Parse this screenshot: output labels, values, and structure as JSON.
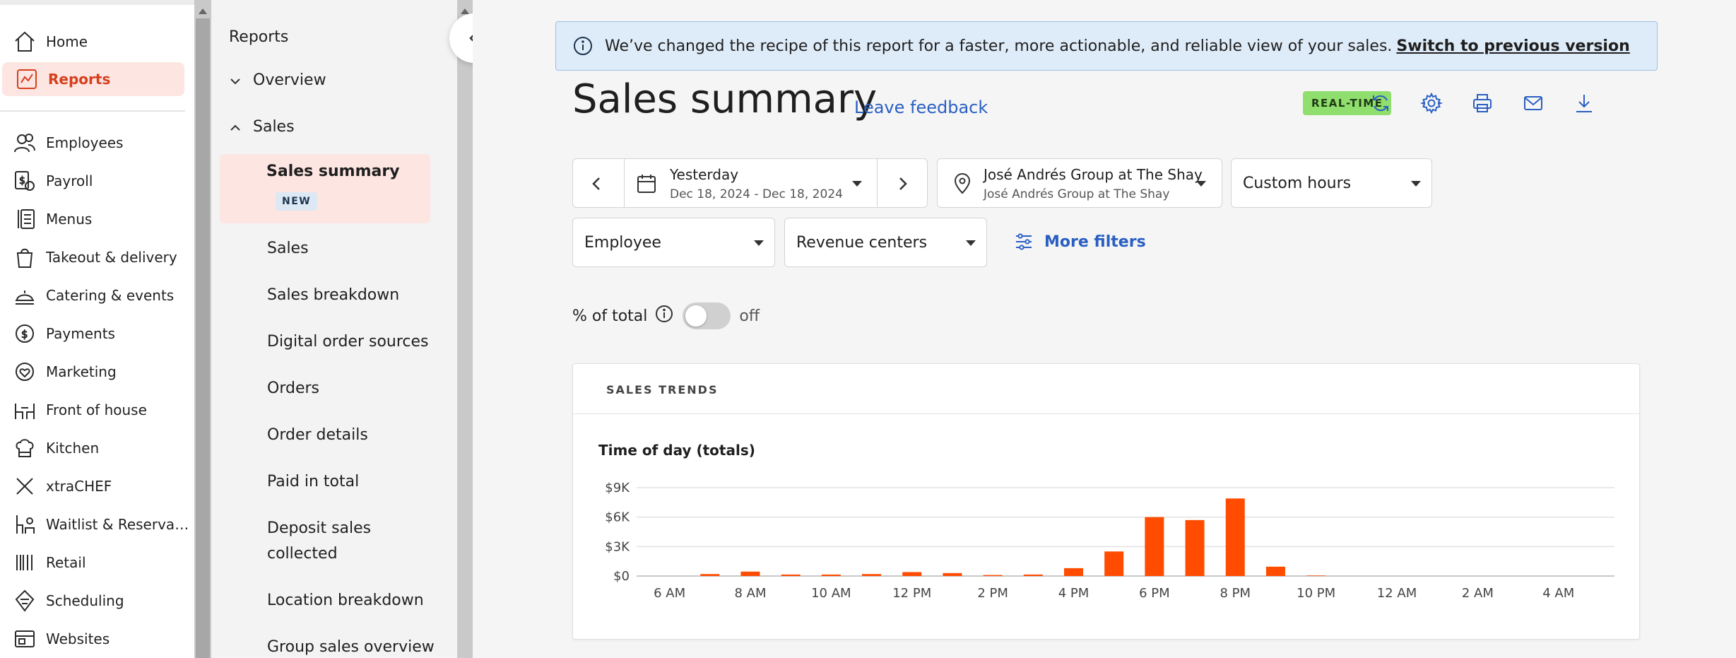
{
  "left_nav": {
    "items": [
      {
        "label": "Home",
        "icon": "home-icon"
      },
      {
        "label": "Reports",
        "icon": "reports-icon",
        "active": true
      },
      {
        "label": "Employees",
        "icon": "employees-icon"
      },
      {
        "label": "Payroll",
        "icon": "payroll-icon"
      },
      {
        "label": "Menus",
        "icon": "menus-icon"
      },
      {
        "label": "Takeout & delivery",
        "icon": "takeout-icon"
      },
      {
        "label": "Catering & events",
        "icon": "catering-icon"
      },
      {
        "label": "Payments",
        "icon": "payments-icon"
      },
      {
        "label": "Marketing",
        "icon": "marketing-icon"
      },
      {
        "label": "Front of house",
        "icon": "front-of-house-icon"
      },
      {
        "label": "Kitchen",
        "icon": "kitchen-icon"
      },
      {
        "label": "xtraCHEF",
        "icon": "xtrachef-icon"
      },
      {
        "label": "Waitlist & Reservati...",
        "icon": "waitlist-icon"
      },
      {
        "label": "Retail",
        "icon": "retail-icon"
      },
      {
        "label": "Scheduling",
        "icon": "scheduling-icon"
      },
      {
        "label": "Websites",
        "icon": "websites-icon"
      }
    ]
  },
  "reports_nav": {
    "title": "Reports",
    "groups": {
      "overview": "Overview",
      "sales": "Sales"
    },
    "active_item": {
      "label": "Sales summary",
      "badge": "NEW"
    },
    "items": [
      "Sales",
      "Sales breakdown",
      "Digital order sources",
      "Orders",
      "Order details",
      "Paid in total",
      "Deposit sales",
      "collected",
      "Location breakdown",
      "Group sales overview"
    ]
  },
  "banner": {
    "text": "We’ve changed the recipe of this report for a faster, more actionable, and reliable view of your sales.",
    "link": "Switch to previous version"
  },
  "header": {
    "title": "Sales summary",
    "feedback_link": "Leave feedback",
    "badge": "REAL-TIME",
    "tools": [
      "refresh-icon",
      "settings-icon",
      "print-icon",
      "email-icon",
      "download-icon"
    ]
  },
  "filters": {
    "date": {
      "label": "Yesterday",
      "range": "Dec 18, 2024 - Dec 18, 2024"
    },
    "location": {
      "label": "José Andrés Group at The Shay",
      "sub": "José Andrés Group at The Shay"
    },
    "hours": "Custom hours",
    "employee": "Employee",
    "revenue_centers": "Revenue centers",
    "more_filters": "More filters"
  },
  "percent_toggle": {
    "label": "% of total",
    "state": "off"
  },
  "trends_card": {
    "header": "SALES TRENDS",
    "chart_title": "Time of day (totals)"
  },
  "colors": {
    "accent": "#d63f1c",
    "bar": "#ff4c00",
    "link": "#2a5fc2",
    "realtime": "#8fde6e"
  },
  "chart_data": {
    "type": "bar",
    "title": "Time of day (totals)",
    "categories": [
      "6 AM",
      "7 AM",
      "8 AM",
      "9 AM",
      "10 AM",
      "11 AM",
      "12 PM",
      "1 PM",
      "2 PM",
      "3 PM",
      "4 PM",
      "5 PM",
      "6 PM",
      "7 PM",
      "8 PM",
      "9 PM",
      "10 PM",
      "11 PM",
      "12 AM",
      "1 AM",
      "2 AM",
      "3 AM",
      "4 AM",
      "5 AM"
    ],
    "x_tick_labels": [
      "6 AM",
      "8 AM",
      "10 AM",
      "12 PM",
      "2 PM",
      "4 PM",
      "6 PM",
      "8 PM",
      "10 PM",
      "12 AM",
      "2 AM",
      "4 AM"
    ],
    "values": [
      0,
      200,
      450,
      150,
      150,
      200,
      400,
      300,
      100,
      150,
      800,
      2500,
      6000,
      5700,
      7900,
      950,
      50,
      0,
      0,
      0,
      0,
      0,
      0,
      0
    ],
    "y_tick_labels": [
      "$0",
      "$3K",
      "$6K",
      "$9K"
    ],
    "y_ticks": [
      0,
      3000,
      6000,
      9000
    ],
    "ylim": [
      0,
      9000
    ],
    "grid": true
  }
}
